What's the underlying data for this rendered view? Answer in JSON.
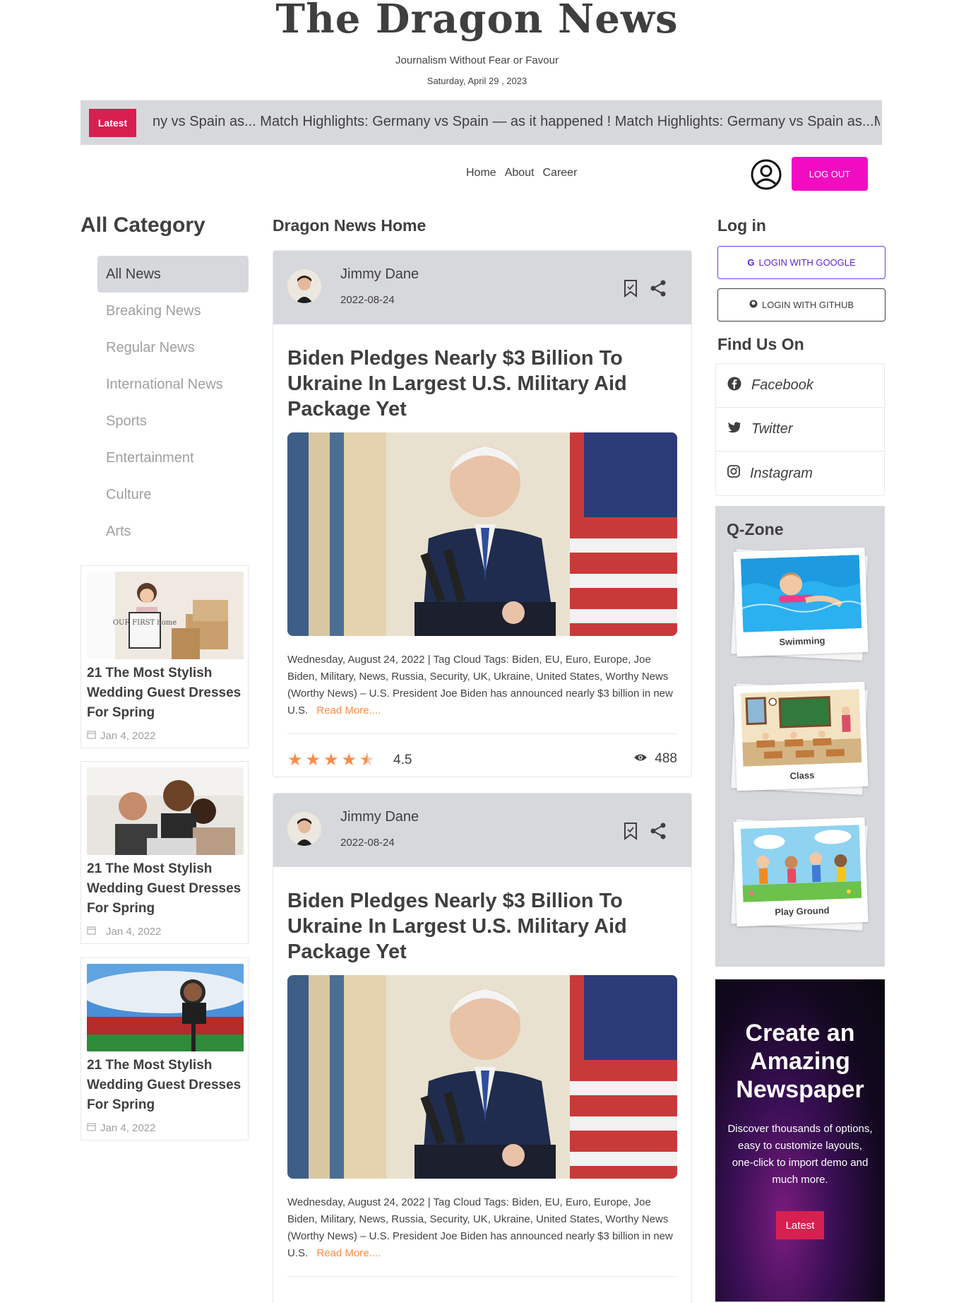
{
  "header": {
    "logo": "The Dragon News",
    "tagline": "Journalism Without Fear or Favour",
    "date": "Saturday, April 29 , 2023"
  },
  "ticker": {
    "button": "Latest",
    "text": "ny vs Spain as... Match Highlights: Germany vs Spain — as it happened ! Match Highlights: Germany vs Spain as...Mat"
  },
  "nav": {
    "links": [
      "Home",
      "About",
      "Career"
    ],
    "logout": "LOG OUT"
  },
  "left": {
    "title": "All Category",
    "categories": [
      "All News",
      "Breaking News",
      "Regular News",
      "International News",
      "Sports",
      "Entertainment",
      "Culture",
      "Arts"
    ],
    "cards": [
      {
        "title": "21 The Most Stylish Wedding Guest Dresses For Spring",
        "date": "Jan 4, 2022",
        "image_text": "OUR FIRST home"
      },
      {
        "title": "21 The Most Stylish Wedding Guest Dresses For Spring",
        "date": "Jan 4, 2022"
      },
      {
        "title": "21 The Most Stylish Wedding Guest Dresses For Spring",
        "date": "Jan 4, 2022"
      }
    ]
  },
  "middle": {
    "title": "Dragon News Home",
    "news": [
      {
        "author": "Jimmy Dane",
        "date": "2022-08-24",
        "title": "Biden Pledges Nearly $3 Billion To Ukraine In Largest U.S. Military Aid Package Yet",
        "body": "Wednesday, August 24, 2022 | Tag Cloud Tags: Biden, EU, Euro, Europe, Joe Biden, Military, News, Russia, Security, UK, Ukraine, United States, Worthy News (Worthy News) – U.S. President Joe Biden has announced nearly $3 billion in new U.S.",
        "read_more": "Read More....",
        "rating": "4.5",
        "views": "488"
      },
      {
        "author": "Jimmy Dane",
        "date": "2022-08-24",
        "title": "Biden Pledges Nearly $3 Billion To Ukraine In Largest U.S. Military Aid Package Yet",
        "body": "Wednesday, August 24, 2022 | Tag Cloud Tags: Biden, EU, Euro, Europe, Joe Biden, Military, News, Russia, Security, UK, Ukraine, United States, Worthy News (Worthy News) – U.S. President Joe Biden has announced nearly $3 billion in new U.S.",
        "read_more": "Read More...."
      }
    ]
  },
  "right": {
    "login_title": "Log in",
    "google": "LOGIN WITH GOOGLE",
    "github": "LOGIN WITH GITHUB",
    "find_title": "Find Us On",
    "social": [
      "Facebook",
      "Twitter",
      "Instagram"
    ],
    "qzone_title": "Q-Zone",
    "qzone_items": [
      "Swimming",
      "Class",
      "Play Ground"
    ],
    "promo": {
      "title": "Create an Amazing Newspaper",
      "text": "Discover thousands of options, easy to customize layouts, one-click to import demo and much more.",
      "button": "Latest"
    }
  },
  "colors": {
    "accent_red": "#d72050",
    "logout_pink": "#f10cc2",
    "google_purple": "#6c3cf0",
    "read_more_orange": "#ff8c47",
    "gray_bg": "#d6d8dc"
  }
}
